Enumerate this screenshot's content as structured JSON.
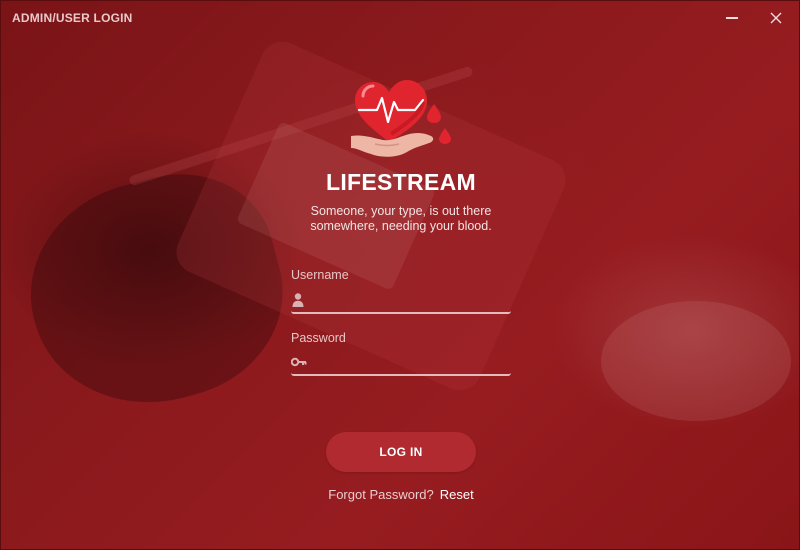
{
  "window": {
    "title": "ADMIN/USER LOGIN",
    "minimize_icon": "minimize-icon",
    "close_icon": "close-icon"
  },
  "brand": {
    "name": "LIFESTREAM",
    "tagline_line1": "Someone, your type, is out there",
    "tagline_line2": "somewhere, needing your blood.",
    "logo_icon": "heart-hand-blood-drop-icon"
  },
  "form": {
    "username": {
      "label": "Username",
      "value": "",
      "placeholder": "",
      "icon": "user-icon"
    },
    "password": {
      "label": "Password",
      "value": "",
      "placeholder": "",
      "icon": "key-icon"
    },
    "login_label": "LOG IN",
    "forgot_text": "Forgot Password?",
    "reset_label": "Reset"
  },
  "colors": {
    "background": "#8c1a1d",
    "button": "#b02a30",
    "accent": "#e2bcbd"
  }
}
